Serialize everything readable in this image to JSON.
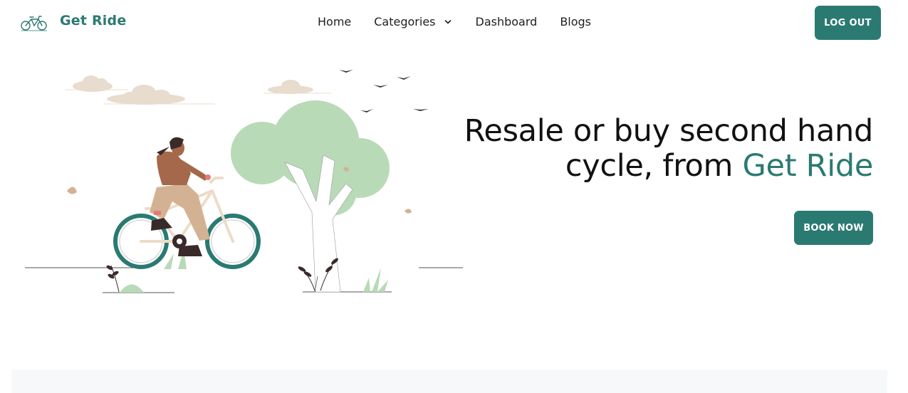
{
  "brand": {
    "name": "Get Ride",
    "logo_icon": "bicycle-icon",
    "color": "#2a7a72"
  },
  "nav": {
    "home": "Home",
    "categories": "Categories",
    "categories_icon": "chevron-down-icon",
    "dashboard": "Dashboard",
    "blogs": "Blogs"
  },
  "header": {
    "logout_label": "LOG OUT"
  },
  "hero": {
    "title_part1": "Resale or buy second hand cycle, from ",
    "title_accent": "Get Ride",
    "book_label": "BOOK NOW",
    "illustration": "woman-riding-bicycle-illustration"
  },
  "colors": {
    "accent": "#2a7a72",
    "tree": "#b9dab7",
    "cloud": "#e7dccd",
    "jacket": "#a5684a",
    "pants": "#d3b294"
  }
}
